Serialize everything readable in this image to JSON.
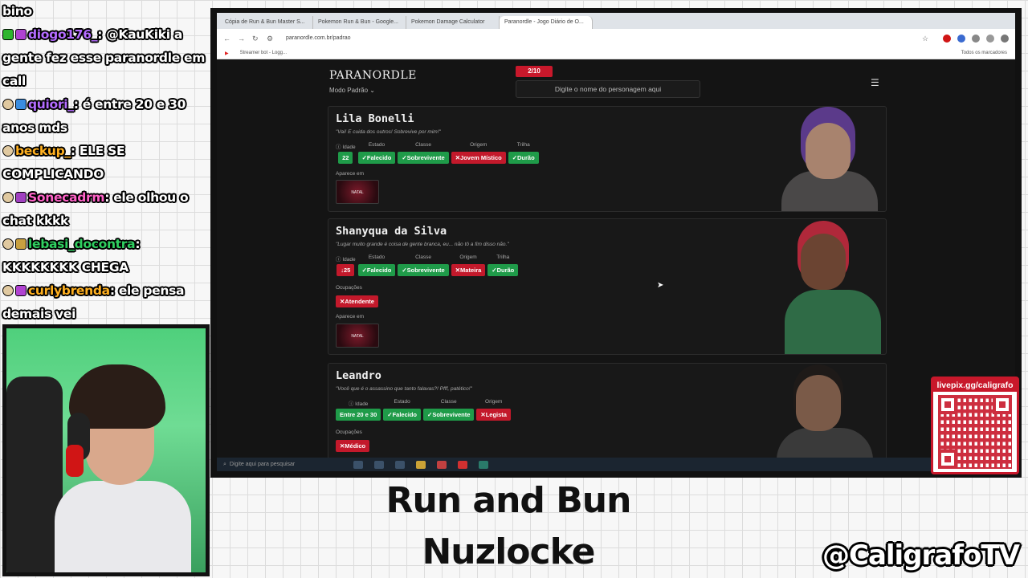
{
  "chat": {
    "lines": [
      {
        "user": "",
        "text": "bino",
        "badges": [],
        "color": "#ffffff"
      },
      {
        "user": "diogo176_",
        "text": ": @KauKiki a gente fez esse paranordle em call",
        "badges": [
          "check",
          "gift"
        ],
        "color": "#b46cff"
      },
      {
        "user": "quiori_",
        "text": ": é entre 20 e 30 anos mds",
        "badges": [
          "head",
          "sub"
        ],
        "color": "#b46cff"
      },
      {
        "user": "beckup_",
        "text": ": ELE SE COMPLICANDO",
        "badges": [
          "head"
        ],
        "color": "#ffb020"
      },
      {
        "user": "Sonecadrm",
        "text": ": ele olhou o chat kkkk",
        "badges": [
          "head",
          "g"
        ],
        "color": "#ff63c8"
      },
      {
        "user": "lebasi_docontra",
        "text": ": KKKKKKKK CHEGA",
        "badges": [
          "head",
          "ctrl"
        ],
        "color": "#30d060"
      },
      {
        "user": "curlybrenda",
        "text": ": ele pensa demais vei",
        "badges": [
          "head",
          "gift"
        ],
        "color": "#ffb020"
      }
    ]
  },
  "browser": {
    "tabs": [
      "Cópia de Run & Bun Master S...",
      "Pokemon Run & Bun - Google...",
      "Pokemon Damage Calculator",
      "Paranordle - Jogo Diário de O..."
    ],
    "url": "paranordle.com.br/padrao",
    "bookmarks": [
      "Streamer bot - Logg..."
    ],
    "bookmarks_right": "Todos os marcadores",
    "taskbar_search": "Digite aqui para pesquisar"
  },
  "site": {
    "logo": "PARANORDLE",
    "mode": "Modo Padrão",
    "counter": "2/10",
    "search_placeholder": "Digite o nome do personagem aqui",
    "labels": {
      "idade": "Idade",
      "estado": "Estado",
      "classe": "Classe",
      "origem": "Origem",
      "trilha": "Trilha",
      "ocupacoes": "Ocupações",
      "aparece": "Aparece em"
    },
    "thumb_text": "NATAL",
    "cards": [
      {
        "name": "Lila Bonelli",
        "quote": "\"Vai! E cuida dos outros! Sobrevive por mim!\"",
        "idade": "22",
        "estado": "Falecido",
        "classe": "Sobrevivente",
        "origem": "Jovem Místico",
        "trilha": "Durão"
      },
      {
        "name": "Shanyqua da Silva",
        "quote": "\"Lugar muito grande é coisa de gente branca, eu... não tô a fim disso não.\"",
        "idade": "25",
        "estado": "Falecido",
        "classe": "Sobrevivente",
        "origem": "Mateira",
        "trilha": "Durão",
        "ocupacao": "Atendente"
      },
      {
        "name": "Leandro",
        "quote": "\"Você que é o assassino que tanto falavas?! Pfff, patético!\"",
        "idade": "Entre 20 e 30",
        "estado": "Falecido",
        "classe": "Sobrevivente",
        "origem": "Legista",
        "ocupacao": "Médico"
      }
    ]
  },
  "overlay": {
    "qr_label": "livepix.gg/caligrafo",
    "title_line1": "Run and Bun",
    "title_line2": "Nuzlocke",
    "handle": "@CaligrafoTV"
  },
  "colors": {
    "correct": "#1f9b49",
    "wrong": "#c3192b",
    "accent": "#c8182b"
  }
}
